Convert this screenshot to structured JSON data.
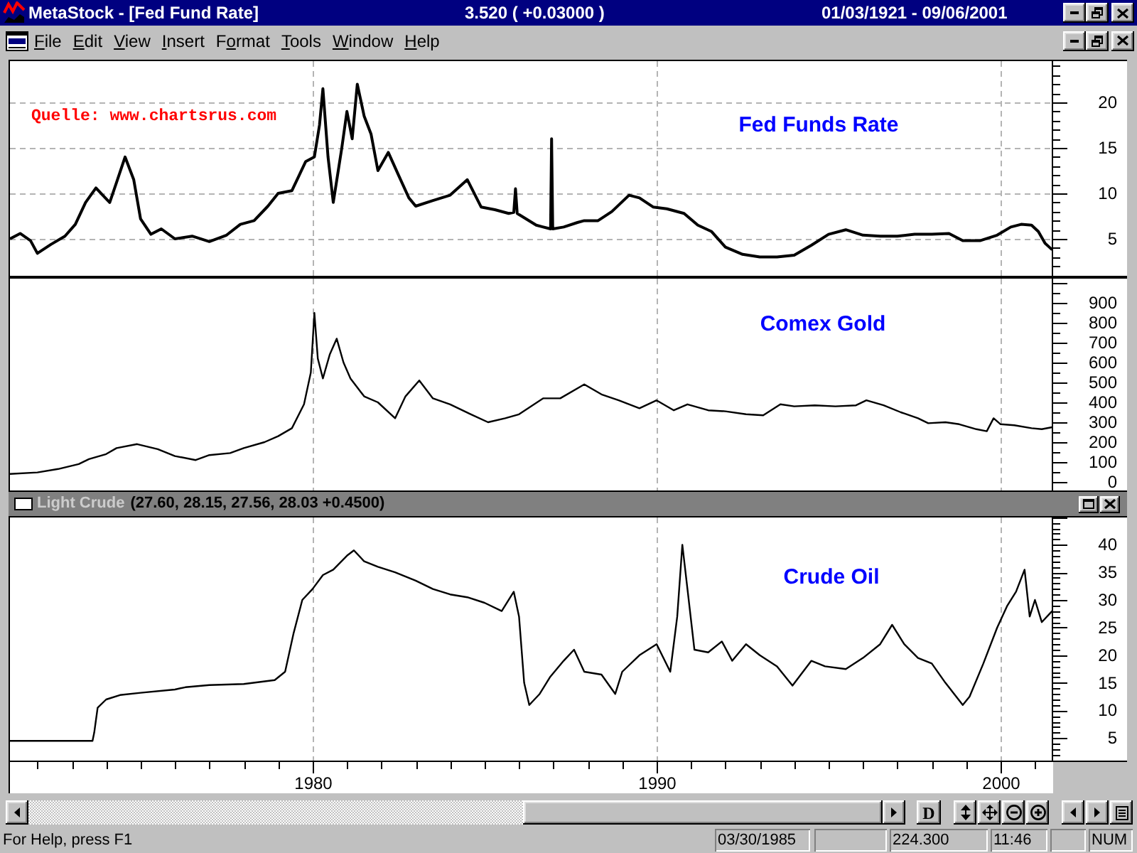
{
  "window": {
    "title": "MetaStock - [Fed Fund Rate]",
    "quote": "3.520 ( +0.03000 )",
    "date_range": "01/03/1921 - 09/06/2001"
  },
  "menu": [
    {
      "hotkey": "F",
      "after": "ile"
    },
    {
      "hotkey": "E",
      "after": "dit"
    },
    {
      "hotkey": "V",
      "after": "iew"
    },
    {
      "hotkey": "I",
      "after": "nsert"
    },
    {
      "before": "F",
      "hotkey": "o",
      "after": "rmat"
    },
    {
      "hotkey": "T",
      "after": "ools"
    },
    {
      "hotkey": "W",
      "after": "indow"
    },
    {
      "hotkey": "H",
      "after": "elp"
    }
  ],
  "panels": [
    {
      "chart_data": {
        "type": "line",
        "title": "Fed Funds Rate",
        "grid": "both",
        "annotations": [
          {
            "text": "Quelle: www.chartsrus.com"
          }
        ],
        "xlim": [
          1971.16,
          2001.53
        ],
        "ylim": [
          0.78,
          24.69
        ],
        "yticks": [
          5,
          10,
          15,
          20
        ],
        "x": [
          1971.2,
          1971.5,
          1971.8,
          1972.0,
          1972.4,
          1972.8,
          1973.1,
          1973.4,
          1973.7,
          1973.9,
          1974.1,
          1974.3,
          1974.55,
          1974.8,
          1975.0,
          1975.3,
          1975.6,
          1976.0,
          1976.5,
          1977.0,
          1977.5,
          1977.9,
          1978.3,
          1978.7,
          1979.0,
          1979.4,
          1979.8,
          1980.05,
          1980.2,
          1980.3,
          1980.45,
          1980.6,
          1980.85,
          1981.0,
          1981.15,
          1981.3,
          1981.5,
          1981.7,
          1981.9,
          1982.2,
          1982.5,
          1982.8,
          1983.0,
          1983.5,
          1984.0,
          1984.5,
          1984.9,
          1985.3,
          1985.7,
          1985.85,
          1985.9,
          1985.95,
          1986.5,
          1986.92,
          1986.95,
          1986.98,
          1987.3,
          1987.7,
          1987.9,
          1988.3,
          1988.7,
          1989.2,
          1989.5,
          1989.9,
          1990.3,
          1990.8,
          1991.2,
          1991.6,
          1992.0,
          1992.5,
          1993.0,
          1993.5,
          1994.0,
          1994.5,
          1995.0,
          1995.5,
          1996.0,
          1996.5,
          1997.0,
          1997.5,
          1998.0,
          1998.5,
          1998.9,
          1999.4,
          1999.9,
          2000.3,
          2000.6,
          2000.9,
          2001.1,
          2001.3,
          2001.5
        ],
        "series": [
          {
            "color": "#000000",
            "values": [
              5.0,
              5.6,
              4.8,
              3.4,
              4.4,
              5.3,
              6.6,
              9.0,
              10.6,
              9.8,
              9.0,
              11.2,
              14.0,
              11.5,
              7.2,
              5.5,
              6.1,
              5.0,
              5.3,
              4.7,
              5.4,
              6.6,
              7.0,
              8.6,
              10.0,
              10.3,
              13.5,
              14.0,
              17.5,
              21.5,
              14.0,
              9.0,
              15.0,
              19.0,
              16.0,
              22.0,
              18.5,
              16.5,
              12.5,
              14.5,
              12.0,
              9.5,
              8.6,
              9.2,
              9.8,
              11.5,
              8.5,
              8.2,
              7.8,
              7.9,
              10.5,
              7.8,
              6.5,
              6.1,
              16.0,
              6.1,
              6.3,
              6.8,
              7.0,
              7.0,
              8.0,
              9.8,
              9.5,
              8.5,
              8.3,
              7.8,
              6.5,
              5.8,
              4.1,
              3.3,
              3.0,
              3.0,
              3.2,
              4.3,
              5.5,
              6.0,
              5.4,
              5.3,
              5.3,
              5.5,
              5.5,
              5.6,
              4.8,
              4.8,
              5.4,
              6.3,
              6.6,
              6.5,
              5.8,
              4.5,
              3.8
            ]
          }
        ]
      }
    },
    {
      "chart_data": {
        "type": "line",
        "title": "Comex Gold",
        "grid": "x",
        "xlim": [
          1971.16,
          2001.53
        ],
        "ylim": [
          -50,
          1029
        ],
        "yticks": [
          0,
          100,
          200,
          300,
          400,
          500,
          600,
          700,
          800,
          900
        ],
        "x": [
          1971.2,
          1972.0,
          1972.6,
          1973.2,
          1973.5,
          1974.0,
          1974.3,
          1974.9,
          1975.5,
          1976.0,
          1976.6,
          1977.0,
          1977.6,
          1978.0,
          1978.6,
          1979.0,
          1979.4,
          1979.75,
          1979.95,
          1980.05,
          1980.15,
          1980.3,
          1980.5,
          1980.7,
          1980.9,
          1981.1,
          1981.5,
          1981.9,
          1982.4,
          1982.7,
          1983.1,
          1983.5,
          1984.0,
          1984.6,
          1985.1,
          1985.6,
          1986.0,
          1986.7,
          1987.2,
          1987.9,
          1988.4,
          1988.9,
          1989.5,
          1990.0,
          1990.5,
          1990.9,
          1991.5,
          1992.0,
          1992.6,
          1993.1,
          1993.6,
          1994.0,
          1994.6,
          1995.2,
          1995.8,
          1996.1,
          1996.6,
          1997.1,
          1997.6,
          1997.9,
          1998.4,
          1998.8,
          1999.3,
          1999.6,
          1999.8,
          2000.0,
          2000.4,
          2000.9,
          2001.2,
          2001.5
        ],
        "series": [
          {
            "color": "#000000",
            "values": [
              40,
              48,
              65,
              90,
              115,
              140,
              170,
              190,
              165,
              130,
              110,
              135,
              145,
              170,
              200,
              230,
              270,
              390,
              550,
              850,
              620,
              520,
              640,
              720,
              600,
              520,
              430,
              400,
              320,
              430,
              510,
              420,
              390,
              340,
              300,
              320,
              340,
              420,
              420,
              490,
              440,
              410,
              370,
              410,
              360,
              390,
              360,
              355,
              340,
              335,
              390,
              380,
              385,
              380,
              385,
              410,
              385,
              350,
              320,
              295,
              300,
              290,
              265,
              255,
              320,
              290,
              285,
              270,
              265,
              275
            ]
          }
        ]
      }
    },
    {
      "header": {
        "name": "Light Crude",
        "values": "(27.60, 28.15, 27.56, 28.03 +0.4500)"
      },
      "chart_data": {
        "type": "line",
        "title": "Crude Oil",
        "grid": "x",
        "xlim": [
          1971.16,
          2001.53
        ],
        "ylim": [
          0.67,
          45.19
        ],
        "xticks": [
          1980,
          1990,
          2000
        ],
        "yticks": [
          5,
          10,
          15,
          20,
          25,
          30,
          35,
          40
        ],
        "x": [
          1971.2,
          1973.6,
          1973.65,
          1973.75,
          1974.0,
          1974.4,
          1975.0,
          1976.0,
          1976.3,
          1977.0,
          1978.0,
          1978.9,
          1979.2,
          1979.45,
          1979.7,
          1980.0,
          1980.3,
          1980.6,
          1981.0,
          1981.2,
          1981.5,
          1981.9,
          1982.4,
          1983.0,
          1983.5,
          1984.0,
          1984.5,
          1985.0,
          1985.5,
          1985.85,
          1986.0,
          1986.15,
          1986.3,
          1986.6,
          1986.9,
          1987.3,
          1987.6,
          1987.9,
          1988.4,
          1988.8,
          1989.0,
          1989.5,
          1990.0,
          1990.4,
          1990.6,
          1990.75,
          1990.9,
          1991.1,
          1991.5,
          1991.9,
          1992.2,
          1992.6,
          1993.0,
          1993.5,
          1993.95,
          1994.5,
          1994.9,
          1995.5,
          1996.0,
          1996.5,
          1996.85,
          1997.2,
          1997.6,
          1998.0,
          1998.4,
          1998.9,
          1999.1,
          1999.5,
          1999.9,
          2000.2,
          2000.45,
          2000.7,
          2000.85,
          2001.0,
          2001.2,
          2001.5
        ],
        "series": [
          {
            "color": "#000000",
            "values": [
              4.5,
              4.5,
              6.0,
              10.5,
              12.0,
              12.8,
              13.2,
              13.8,
              14.2,
              14.6,
              14.8,
              15.5,
              17.0,
              24.0,
              30.0,
              32.0,
              34.5,
              35.5,
              38.0,
              39.0,
              37.0,
              36.0,
              35.0,
              33.5,
              32.0,
              31.0,
              30.5,
              29.5,
              28.0,
              31.5,
              27.0,
              15.0,
              11.0,
              13.0,
              16.0,
              19.0,
              21.0,
              17.0,
              16.5,
              13.0,
              17.0,
              20.0,
              22.0,
              17.0,
              27.0,
              40.0,
              32.0,
              21.0,
              20.5,
              22.5,
              19.0,
              22.0,
              20.0,
              18.0,
              14.5,
              19.0,
              18.0,
              17.5,
              19.5,
              22.0,
              25.5,
              22.0,
              19.5,
              18.5,
              15.0,
              11.0,
              12.5,
              18.5,
              25.0,
              29.0,
              31.5,
              35.5,
              27.0,
              30.0,
              26.0,
              28.0
            ]
          }
        ]
      }
    }
  ],
  "scroll_bar": {
    "day_button": "D"
  },
  "status_bar": {
    "help": "For Help, press F1",
    "panes": [
      {
        "kind": "text",
        "text": "03/30/1985"
      },
      {
        "kind": "blank"
      },
      {
        "kind": "text",
        "text": "224.300"
      },
      {
        "kind": "text",
        "text": "11:46"
      },
      {
        "kind": "blank"
      },
      {
        "kind": "text",
        "text": "NUM"
      }
    ]
  }
}
